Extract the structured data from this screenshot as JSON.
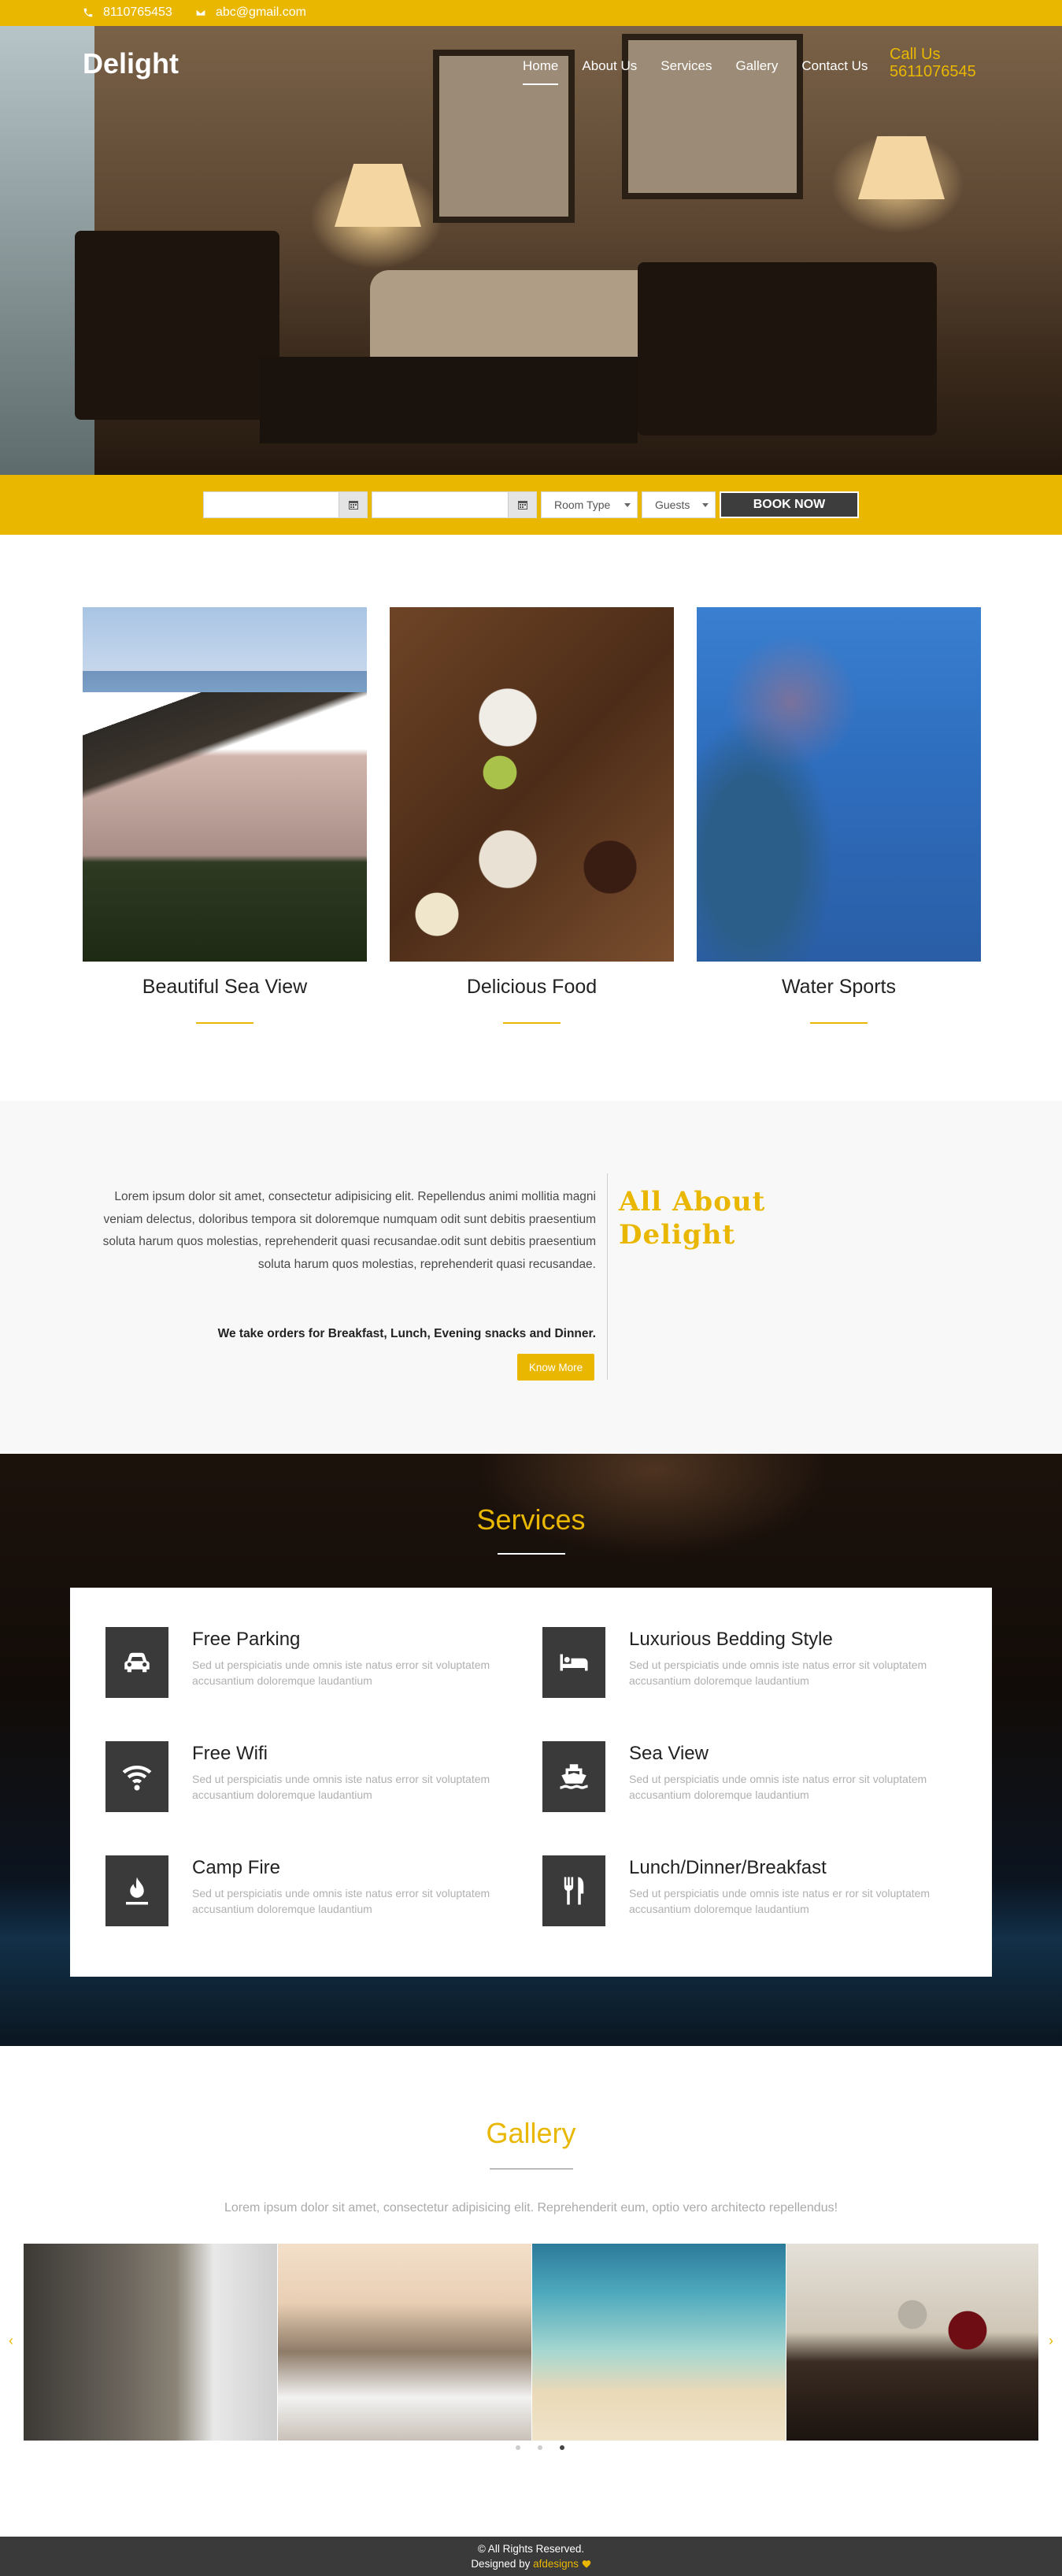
{
  "topbar": {
    "phone": "8110765453",
    "email": "abc@gmail.com",
    "icons": [
      "phone-icon",
      "envelope-icon"
    ]
  },
  "header": {
    "brand": "Delight",
    "nav": [
      "Home",
      "About Us",
      "Services",
      "Gallery",
      "Contact Us"
    ],
    "active_nav": "Home",
    "call_label": "Call Us",
    "call_number": "5611076545"
  },
  "booking": {
    "checkin_value": "",
    "checkout_value": "",
    "room_type": "Room Type",
    "guests": "Guests",
    "book_label": "BOOK NOW",
    "icons": [
      "calendar-icon",
      "calendar-icon"
    ]
  },
  "features": [
    {
      "caption": "Beautiful Sea View"
    },
    {
      "caption": "Delicious Food"
    },
    {
      "caption": "Water Sports"
    }
  ],
  "about": {
    "paragraph": "Lorem ipsum dolor sit amet, consectetur adipisicing elit. Repellendus animi mollitia magni veniam delectus, doloribus tempora sit doloremque numquam odit sunt debitis praesentium soluta harum quos molestias, reprehenderit quasi recusandae.odit sunt debitis praesentium soluta harum quos molestias, reprehenderit quasi recusandae.",
    "orders": "We take orders for Breakfast, Lunch, Evening snacks and Dinner.",
    "button": "Know More",
    "title_line1": "All About",
    "title_line2": "Delight"
  },
  "services": {
    "title": "Services",
    "items": [
      {
        "title": "Free Parking",
        "desc": "Sed ut perspiciatis unde omnis iste natus error sit voluptatem accusantium doloremque laudantium",
        "icon": "car-icon"
      },
      {
        "title": "Luxurious Bedding Style",
        "desc": "Sed ut perspiciatis unde omnis iste natus error sit voluptatem accusantium doloremque laudantium",
        "icon": "bed-icon"
      },
      {
        "title": "Free Wifi",
        "desc": "Sed ut perspiciatis unde omnis iste natus error sit voluptatem accusantium doloremque laudantium",
        "icon": "wifi-icon"
      },
      {
        "title": "Sea View",
        "desc": "Sed ut perspiciatis unde omnis iste natus error sit voluptatem accusantium doloremque laudantium",
        "icon": "ship-icon"
      },
      {
        "title": "Camp Fire",
        "desc": "Sed ut perspiciatis unde omnis iste natus error sit voluptatem accusantium doloremque laudantium",
        "icon": "fire-icon"
      },
      {
        "title": "Lunch/Dinner/Breakfast",
        "desc": "Sed ut perspiciatis unde omnis iste natus er ror sit voluptatem accusantium doloremque laudantium",
        "icon": "cutlery-icon"
      }
    ]
  },
  "gallery": {
    "title": "Gallery",
    "subtitle": "Lorem ipsum dolor sit amet, consectetur adipisicing elit. Reprehenderit eum, optio vero architecto repellendus!",
    "active_dot": 3,
    "dot_count": 3
  },
  "footer": {
    "rights": "© All Rights Reserved.",
    "designed_prefix": "Designed by ",
    "designer": "afdesigns",
    "heart_icon": "heart-icon"
  },
  "colors": {
    "accent": "#eab700",
    "dark": "#3a3a3a"
  }
}
